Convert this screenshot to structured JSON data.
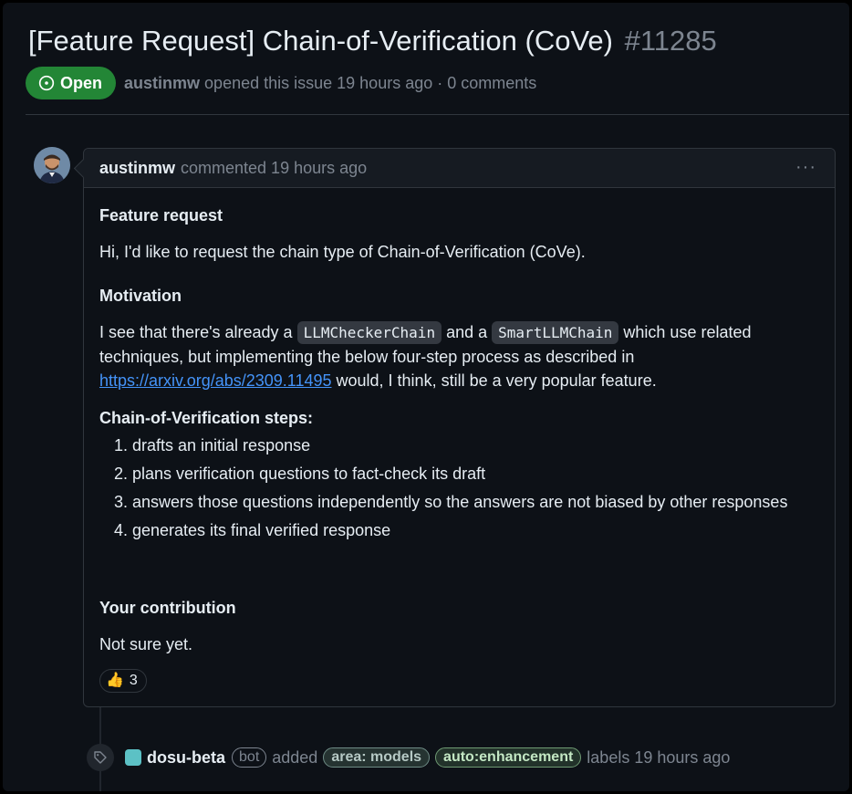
{
  "issue": {
    "title": "[Feature Request] Chain-of-Verification (CoVe)",
    "number": "#11285",
    "state_label": "Open",
    "author": "austinmw",
    "opened_text": "opened this issue 19 hours ago · 0 comments"
  },
  "comment": {
    "author": "austinmw",
    "meta": "commented 19 hours ago",
    "menu": "···",
    "feature_heading": "Feature request",
    "feature_text": "Hi, I'd like to request the chain type of Chain-of-Verification (CoVe).",
    "motivation_heading": "Motivation",
    "motivation_pre": "I see that there's already a",
    "code1": "LLMCheckerChain",
    "motivation_mid": "and a",
    "code2": "SmartLLMChain",
    "motivation_post": "which use related techniques, but implementing the below four-step process as described in",
    "link": "https://arxiv.org/abs/2309.11495",
    "motivation_end": "would, I think, still be a very popular feature.",
    "steps_heading": "Chain-of-Verification steps:",
    "steps": [
      "drafts an initial response",
      "plans verification questions to fact-check its draft",
      "answers those questions independently so the answers are not biased by other responses",
      "generates its final verified response"
    ],
    "contribution_heading": "Your contribution",
    "contribution_text": "Not sure yet.",
    "reaction_emoji": "👍",
    "reaction_count": "3"
  },
  "event": {
    "actor": "dosu-beta",
    "bot_badge": "bot",
    "action": "added",
    "labels": [
      "area: models",
      "auto:enhancement"
    ],
    "suffix": "labels 19 hours ago"
  },
  "colors": {
    "open_green": "#238636",
    "link_blue": "#4493f8",
    "bg": "#0d1117"
  }
}
